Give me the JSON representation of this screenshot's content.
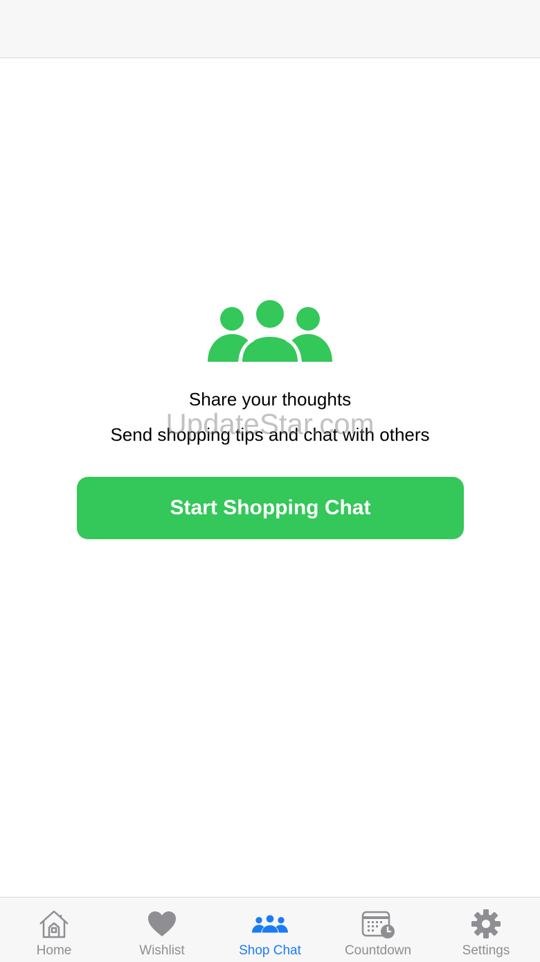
{
  "colors": {
    "accent_green": "#34c759",
    "tab_active": "#1a7cf5",
    "tab_inactive": "#8e8e93",
    "bar_background": "#f7f7f7"
  },
  "hero": {
    "icon": "group-people-icon",
    "headline": "Share your thoughts",
    "subline": "Send shopping tips and chat with others"
  },
  "watermark": "UpdateStar.com",
  "cta": {
    "label": "Start Shopping Chat"
  },
  "tabs": [
    {
      "label": "Home",
      "icon": "house-icon",
      "active": false
    },
    {
      "label": "Wishlist",
      "icon": "heart-icon",
      "active": false
    },
    {
      "label": "Shop Chat",
      "icon": "group-people-icon",
      "active": true
    },
    {
      "label": "Countdown",
      "icon": "calendar-clock-icon",
      "active": false
    },
    {
      "label": "Settings",
      "icon": "gear-icon",
      "active": false
    }
  ]
}
